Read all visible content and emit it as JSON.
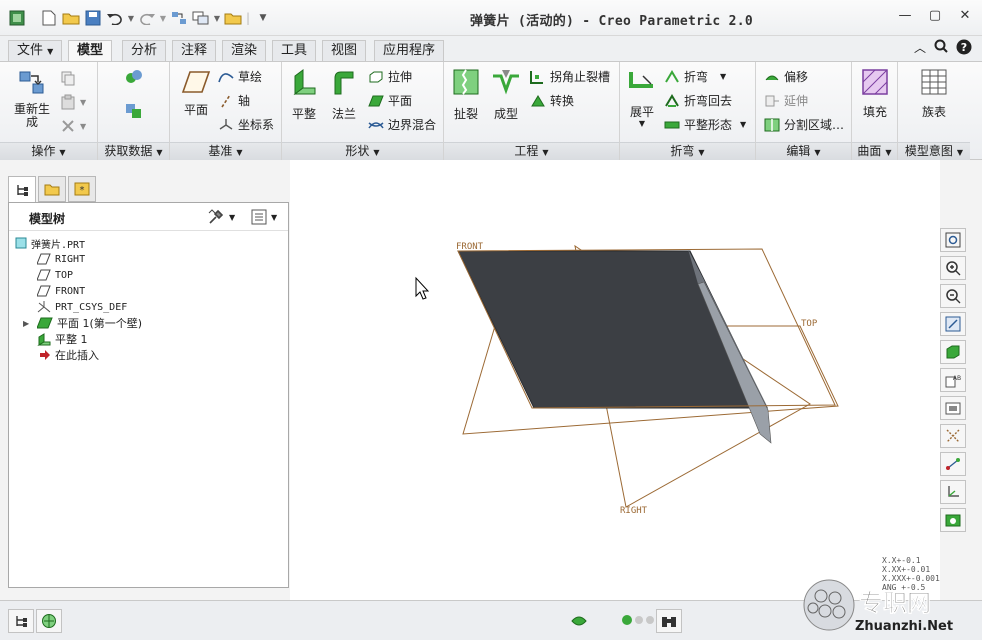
{
  "window": {
    "title": "弹簧片 (活动的) - Creo Parametric 2.0"
  },
  "quick_access": [
    "app-icon",
    "new-icon",
    "open-icon",
    "save-icon",
    "undo-icon",
    "redo-icon",
    "regenerate-icon",
    "window-icon",
    "folder-icon",
    "more-icon"
  ],
  "tabs": [
    {
      "label": "文件",
      "dropdown": true
    },
    {
      "label": "模型",
      "active": true
    },
    {
      "label": "分析"
    },
    {
      "label": "注释"
    },
    {
      "label": "渲染"
    },
    {
      "label": "工具"
    },
    {
      "label": "视图"
    },
    {
      "label": "应用程序"
    }
  ],
  "ribbon": {
    "operations": {
      "label": "操作",
      "regen": "重新生\n成"
    },
    "get_data": {
      "label": "获取数据"
    },
    "datum": {
      "label": "基准",
      "plane": "平面",
      "sketch": "草绘",
      "axis": "轴",
      "csys": "坐标系"
    },
    "shapes": {
      "label": "形状",
      "planar": "平整",
      "flange": "法兰",
      "extrude": "拉伸",
      "plane": "平面",
      "blend": "边界混合"
    },
    "engineering": {
      "label": "工程",
      "rip": "扯裂",
      "form": "成型",
      "corner_relief": "拐角止裂槽",
      "convert": "转换"
    },
    "bends": {
      "label": "折弯",
      "unbend": "展平",
      "bend": "折弯",
      "bend_back": "折弯回去",
      "flat_state": "平整形态"
    },
    "editing": {
      "label": "编辑",
      "offset": "偏移",
      "extend": "延伸",
      "split_region": "分割区域…"
    },
    "surfaces": {
      "label": "曲面",
      "fill": "填充"
    },
    "model_intent": {
      "label": "模型意图",
      "family_table": "族表"
    }
  },
  "model_tree": {
    "title": "模型树",
    "items": [
      {
        "label": "弹簧片.PRT",
        "icon": "part-icon"
      },
      {
        "label": "RIGHT",
        "icon": "datum-plane-icon"
      },
      {
        "label": "TOP",
        "icon": "datum-plane-icon"
      },
      {
        "label": "FRONT",
        "icon": "datum-plane-icon"
      },
      {
        "label": "PRT_CSYS_DEF",
        "icon": "csys-icon"
      },
      {
        "label": "平面 1(第一个壁)",
        "icon": "planar-wall-icon"
      },
      {
        "label": "平整 1",
        "icon": "flat-wall-icon"
      },
      {
        "label": "在此插入",
        "icon": "insert-here-icon"
      }
    ]
  },
  "viewport": {
    "datum_labels": {
      "front": "FRONT",
      "top": "TOP",
      "right": "RIGHT"
    }
  },
  "precision": [
    "X.X+-0.1",
    "X.XX+-0.01",
    "X.XXX+-0.001",
    "ANG +-0.5"
  ],
  "watermark": {
    "brand": "专职网",
    "url": "Zhuanzhi.Net"
  },
  "colors": {
    "datum_orange": "#9c6a35",
    "part_dark": "#3c3f44",
    "accent_green": "#3aa83a"
  }
}
